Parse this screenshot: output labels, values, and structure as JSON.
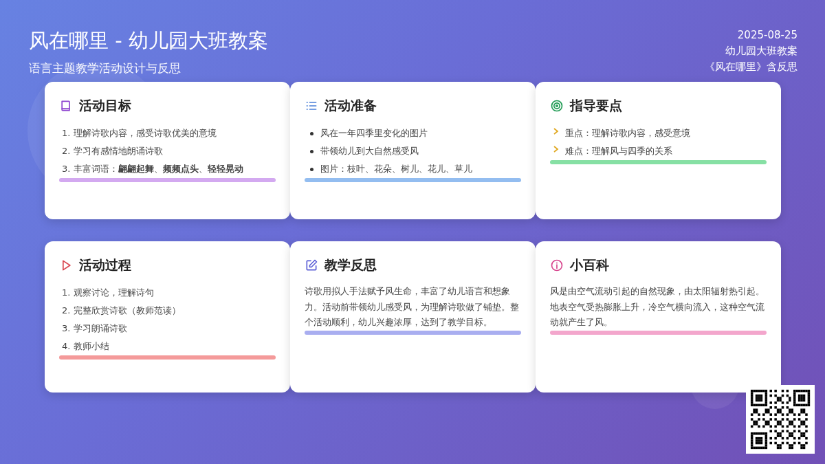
{
  "header": {
    "title": "风在哪里 - 幼儿园大班教案",
    "subtitle": "语言主题教学活动设计与反思",
    "date": "2025-08-25",
    "meta_lines": [
      "幼儿园大班教案",
      "《风在哪里》含反思"
    ]
  },
  "cards": [
    {
      "title": "活动目标",
      "kind": "ordered",
      "color": "#d3a9f0",
      "items": [
        "1. 理解诗歌内容，感受诗歌优美的意境",
        "2. 学习有感情地朗诵诗歌",
        "3. 丰富词语：**翩翩起舞**、**频频点头**、**轻轻晃动**"
      ]
    },
    {
      "title": "活动准备",
      "kind": "bullet",
      "color": "#93bdf0",
      "items": [
        "风在一年四季里变化的图片",
        "带领幼儿到大自然感受风",
        "图片：枝叶、花朵、树儿、花儿、草儿"
      ]
    },
    {
      "title": "指导要点",
      "kind": "points",
      "color": "#86e0a4",
      "items": [
        "重点：理解诗歌内容，感受意境",
        "难点：理解风与四季的关系"
      ]
    },
    {
      "title": "活动过程",
      "kind": "ordered",
      "color": "#f49a9a",
      "items": [
        "1. 观察讨论，理解诗句",
        "2. 完整欣赏诗歌（教师范读）",
        "3. 学习朗诵诗歌",
        "4. 教师小结"
      ]
    },
    {
      "title": "教学反思",
      "kind": "paragraph",
      "color": "#a9aef0",
      "text": "诗歌用拟人手法赋予风生命，丰富了幼儿语言和想象力。活动前带领幼儿感受风，为理解诗歌做了铺垫。整个活动顺利，幼儿兴趣浓厚，达到了教学目标。"
    },
    {
      "title": "小百科",
      "kind": "paragraph",
      "color": "#f3a6cc",
      "text": "风是由空气流动引起的自然现象，由太阳辐射热引起。地表空气受热膨胀上升，冷空气横向流入，这种空气流动就产生了风。"
    }
  ]
}
